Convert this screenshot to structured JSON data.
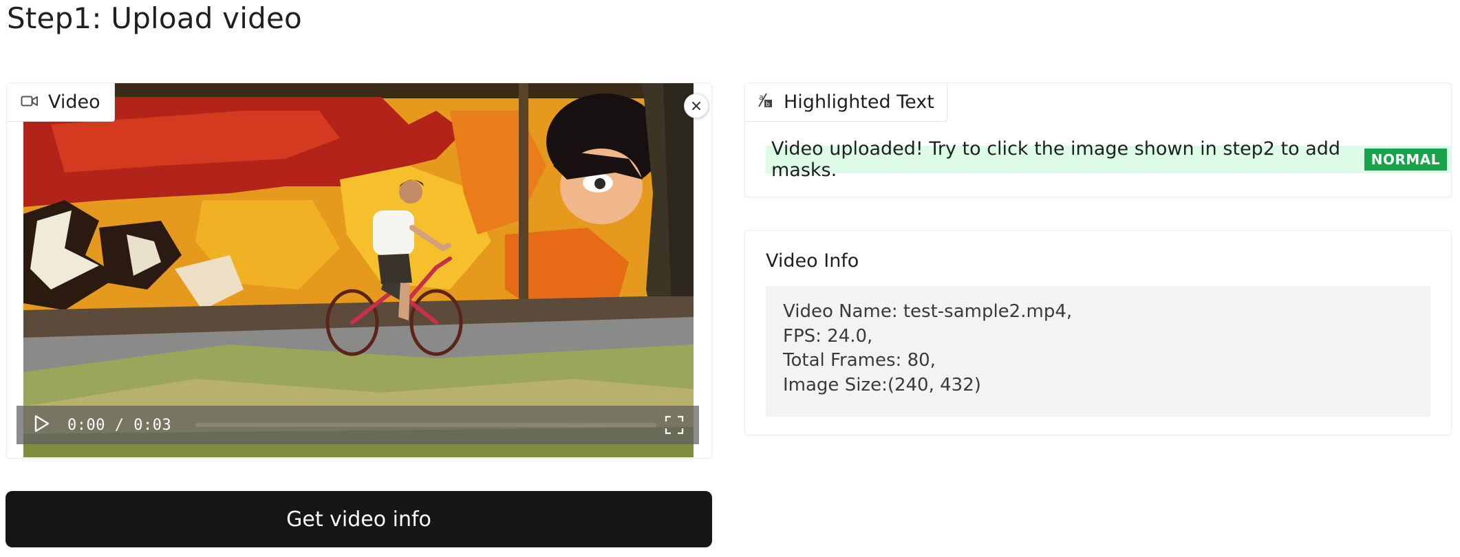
{
  "page": {
    "title": "Step1: Upload video"
  },
  "video_block": {
    "label": "Video",
    "icon": "video-camera-icon",
    "close_icon": "close-icon",
    "player": {
      "current_time": "0:00",
      "duration": "0:03",
      "time_display": "0:00 / 0:03",
      "progress": 0,
      "play_icon": "play-icon",
      "fullscreen_icon": "fullscreen-icon"
    }
  },
  "get_info_button": {
    "label": "Get video info"
  },
  "highlighted_text": {
    "label": "Highlighted Text",
    "icon": "highlighted-text-icon",
    "text": "Video uploaded! Try to click the image shown in step2 to add masks.",
    "badge": "NORMAL",
    "colors": {
      "highlight_bg": "#dcfce7",
      "badge_bg": "#16a34a"
    }
  },
  "video_info": {
    "label": "Video Info",
    "lines": [
      "Video Name: test-sample2.mp4,",
      "FPS: 24.0,",
      "Total Frames: 80,",
      "Image Size:(240, 432)"
    ]
  },
  "colors": {
    "button_bg": "#161616",
    "button_text": "#ffffff"
  }
}
